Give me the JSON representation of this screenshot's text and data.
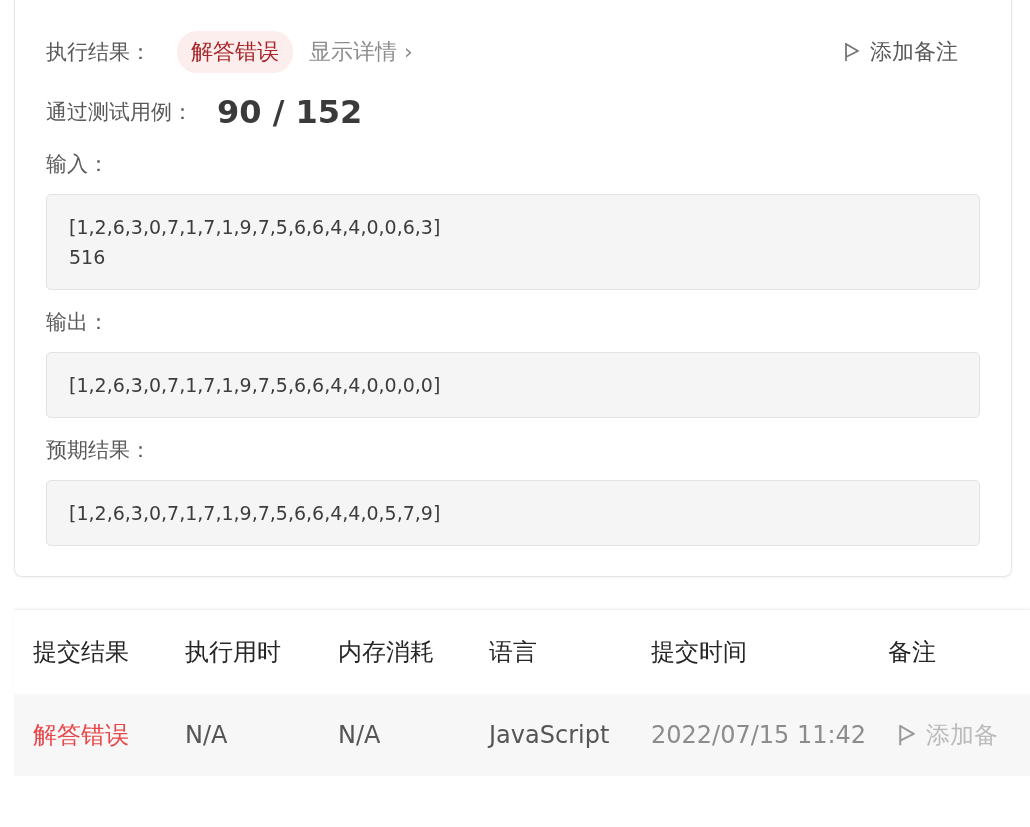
{
  "result": {
    "label": "执行结果：",
    "status": "解答错误",
    "details_link": "显示详情 ›",
    "add_note": "添加备注"
  },
  "passed": {
    "label": "通过测试用例：",
    "passed": "90",
    "separator": "/",
    "total": "152"
  },
  "sections": [
    {
      "label": "输入：",
      "lines": [
        "[1,2,6,3,0,7,1,7,1,9,7,5,6,6,4,4,0,0,6,3]",
        "516"
      ]
    },
    {
      "label": "输出：",
      "lines": [
        "[1,2,6,3,0,7,1,7,1,9,7,5,6,6,4,4,0,0,0,0]"
      ]
    },
    {
      "label": "预期结果：",
      "lines": [
        "[1,2,6,3,0,7,1,7,1,9,7,5,6,6,4,4,0,5,7,9]"
      ]
    }
  ],
  "table": {
    "columns": [
      "提交结果",
      "执行用时",
      "内存消耗",
      "语言",
      "提交时间",
      "备注"
    ],
    "rows": [
      {
        "status": "解答错误",
        "time": "N/A",
        "memory": "N/A",
        "language": "JavaScript",
        "submitted": "2022/07/15 11:42",
        "note": "添加备"
      }
    ]
  }
}
